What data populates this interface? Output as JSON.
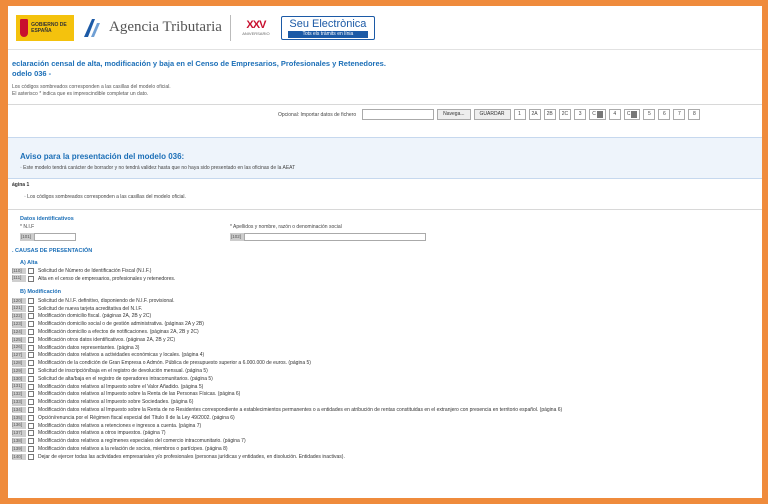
{
  "header": {
    "gobierno_text": "GOBIERNO DE ESPAÑA",
    "agency_name": "Agencia Tributaria",
    "anniv_big": "XXV",
    "anniv_small": "ANIVERSARIO",
    "seu_title": "Seu Electrònica",
    "seu_subtitle": "Tots els tràmits en línia"
  },
  "page": {
    "title": "eclaración censal de alta, modificación y baja en el Censo de Empresarios, Profesionales y Retenedores.",
    "subtitle": "odelo 036 -",
    "intro1": "Los códigos sombreados corresponden a las casillas del modelo oficial.",
    "intro2": "El asterisco * indica que es imprescindible completar un dato."
  },
  "toolbar": {
    "import_label": "Opcional: Importar datos de fichero",
    "browse_label": "Navega...",
    "save_label": "GUARDAR",
    "pages": [
      "1",
      "2A",
      "2B",
      "2C",
      "3",
      "C",
      "4",
      "C",
      "5",
      "6",
      "7",
      "8"
    ]
  },
  "aviso": {
    "heading": "Aviso para la presentación del modelo 036:",
    "text": "Este modelo tendrá carácter de borrador y no tendrá validez hasta que no haya sido presentado en las oficinas de la AEAT"
  },
  "pagina": {
    "label": "ágina 1",
    "note": "Los códigos sombreados corresponden a las casillas del modelo oficial."
  },
  "datos": {
    "section": "Datos identificativos",
    "nif_label": "* N.I.F",
    "nif_code": "[101]",
    "name_label": "* Apellidos y nombre, razón o denominación social",
    "name_code": "[102]"
  },
  "causas": {
    "section": ". CAUSAS DE PRESENTACIÓN",
    "alta_label": "A) Alta",
    "alta_items": [
      {
        "code": "[110]",
        "text": "Solicitud de Número de Identificación Fiscal (N.I.F.)"
      },
      {
        "code": "[111]",
        "text": "Alta en el censo de empresarios, profesionales y retenedores."
      }
    ],
    "mod_label": "B) Modificación",
    "mod_items": [
      {
        "code": "[120]",
        "text": "Solicitud de N.I.F. definitivo, disponiendo de N.I.F. provisional."
      },
      {
        "code": "[121]",
        "text": "Solicitud de nueva tarjeta acreditativa del N.I.F."
      },
      {
        "code": "[122]",
        "text": "Modificación domicilio fiscal. (páginas 2A, 2B y 2C)"
      },
      {
        "code": "[123]",
        "text": "Modificación domicilio social o de gestión administrativa. (páginas 2A y 2B)"
      },
      {
        "code": "[124]",
        "text": "Modificación domicilio a efectos de notificaciones. (páginas 2A, 2B y 2C)"
      },
      {
        "code": "[125]",
        "text": "Modificación otros datos identificativos. (páginas 2A, 2B y 2C)"
      },
      {
        "code": "[126]",
        "text": "Modificación datos representantes. (página 3)"
      },
      {
        "code": "[127]",
        "text": "Modificación datos relativos a actividades económicas y locales. (página 4)"
      },
      {
        "code": "[128]",
        "text": "Modificación de la condición de Gran Empresa o Admón. Pública de presupuesto superior a 6.000.000 de euros. (página 5)"
      },
      {
        "code": "[129]",
        "text": "Solicitud de inscripción/baja en el registro de devolución mensual. (página 5)"
      },
      {
        "code": "[130]",
        "text": "Solicitud de alta/baja en el registro de operadores intracomunitarios. (página 5)"
      },
      {
        "code": "[131]",
        "text": "Modificación datos relativos al Impuesto sobre el Valor Añadido. (página 5)"
      },
      {
        "code": "[132]",
        "text": "Modificación datos relativos al Impuesto sobre la Renta de las Personas Físicas. (página 6)"
      },
      {
        "code": "[133]",
        "text": "Modificación datos relativos al Impuesto sobre Sociedades. (página 6)"
      },
      {
        "code": "[134]",
        "text": "Modificación datos relativos al Impuesto sobre la Renta de no Residentes correspondiente a establecimientos permanentes o a entidades en atribución de rentas constituidas en el extranjero con presencia en territorio español. (página 6)"
      },
      {
        "code": "[135]",
        "text": "Opción/renuncia por el Régimen fiscal especial del Título II de la Ley 49/2002. (página 6)"
      },
      {
        "code": "[136]",
        "text": "Modificación datos relativos a retenciones e ingresos a cuenta. (página 7)"
      },
      {
        "code": "[137]",
        "text": "Modificación datos relativos a otros impuestos. (página 7)"
      },
      {
        "code": "[138]",
        "text": "Modificación datos relativos a regímenes especiales del comercio intracomunitario. (página 7)"
      },
      {
        "code": "[139]",
        "text": "Modificación datos relativos a la relación de socios, miembros o partícipes. (página 8)"
      },
      {
        "code": "[140]",
        "text": "Dejar de ejercer todas las actividades empresariales y/o profesionales (personas jurídicas y entidades, en disolución. Entidades inactivas)."
      }
    ]
  }
}
